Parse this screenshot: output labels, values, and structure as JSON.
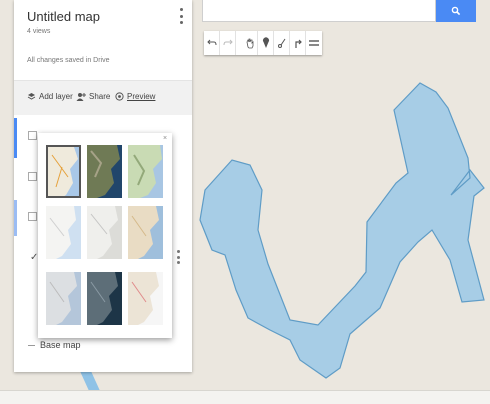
{
  "panel": {
    "title": "Untitled map",
    "views": "4 views",
    "save_status": "All changes saved in Drive",
    "actions": {
      "add_layer": "Add layer",
      "share": "Share",
      "preview": "Preview"
    },
    "base_map_label": "Base map"
  },
  "search": {
    "placeholder": "",
    "button_icon": "search-icon"
  },
  "toolbar": {
    "tools": [
      "undo-icon",
      "redo-icon",
      "hand-icon",
      "marker-icon",
      "draw-line-icon",
      "directions-icon",
      "ruler-icon"
    ]
  },
  "basemap_styles": [
    {
      "name": "map",
      "selected": true
    },
    {
      "name": "satellite",
      "selected": false
    },
    {
      "name": "terrain",
      "selected": false
    },
    {
      "name": "light political",
      "selected": false
    },
    {
      "name": "mono city",
      "selected": false
    },
    {
      "name": "simple atlas",
      "selected": false
    },
    {
      "name": "light landmass",
      "selected": false
    },
    {
      "name": "dark landmass",
      "selected": false
    },
    {
      "name": "whitewater",
      "selected": false
    }
  ],
  "colors": {
    "accent": "#4a8af4",
    "polygon_fill": "#a7cde6",
    "polygon_stroke": "#5f9cc6",
    "map_background": "#ebe7df"
  }
}
